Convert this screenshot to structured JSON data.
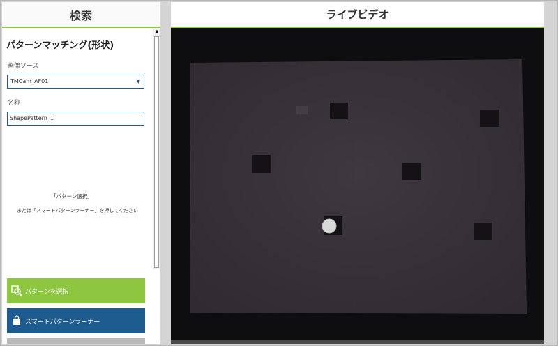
{
  "search_panel": {
    "header": "検索",
    "title": "パターンマッチング(形状)",
    "image_source_label": "画像ソース",
    "image_source_value": "TMCam_AF01",
    "name_label": "名称",
    "name_value": "ShapePattern_1",
    "hint_line1": "「パターン選択」",
    "hint_line2": "または「スマートパターンラーナー」を押してください",
    "select_pattern_button": "パターンを選択",
    "smart_learner_button": "スマートパターンラーナー"
  },
  "live_panel": {
    "header": "ライブビデオ"
  },
  "colors": {
    "accent_green": "#8dc63f",
    "accent_blue": "#1e5b8e"
  },
  "icons": {
    "scroll_up": "scroll-up-arrow-icon",
    "dropdown": "chevron-down-icon",
    "pattern": "pattern-search-icon",
    "smart": "smart-bag-icon"
  }
}
